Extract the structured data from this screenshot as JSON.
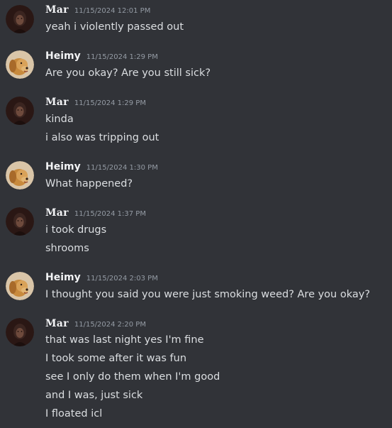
{
  "messages": [
    {
      "author": "Mar",
      "timestamp": "11/15/2024 12:01 PM",
      "lines": [
        "yeah i violently passed out"
      ]
    },
    {
      "author": "Heimy",
      "timestamp": "11/15/2024 1:29 PM",
      "lines": [
        "Are you okay? Are you still sick?"
      ]
    },
    {
      "author": "Mar",
      "timestamp": "11/15/2024 1:29 PM",
      "lines": [
        "kinda",
        "i also was tripping out"
      ]
    },
    {
      "author": "Heimy",
      "timestamp": "11/15/2024 1:30 PM",
      "lines": [
        "What happened?"
      ]
    },
    {
      "author": "Mar",
      "timestamp": "11/15/2024 1:37 PM",
      "lines": [
        "i took drugs",
        "shrooms"
      ]
    },
    {
      "author": "Heimy",
      "timestamp": "11/15/2024 2:03 PM",
      "lines": [
        "I thought you said you were just smoking weed? Are you okay?"
      ]
    },
    {
      "author": "Mar",
      "timestamp": "11/15/2024 2:20 PM",
      "lines": [
        "that was last night yes I'm fine",
        "I took some after it was fun",
        "see I only do them when I'm good",
        "and I was, just sick",
        "I floated icl"
      ]
    }
  ],
  "avatars": {
    "Mar": "dark-portrait-avatar-icon",
    "Heimy": "golden-retriever-avatar-icon"
  },
  "colors": {
    "background": "#313338",
    "username": "#f2f3f5",
    "timestamp": "#949ba4",
    "message_text": "#dbdee1"
  }
}
